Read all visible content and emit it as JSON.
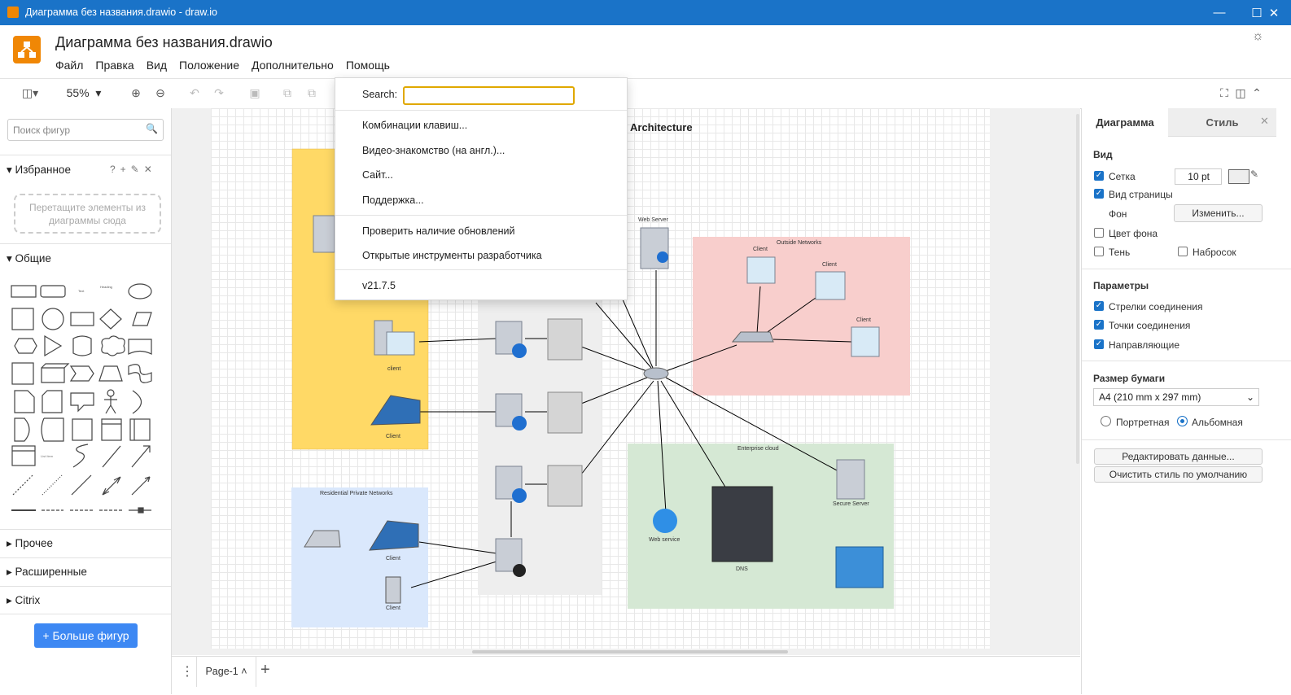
{
  "window": {
    "title": "Диаграмма без названия.drawio - draw.io",
    "controls": [
      "minimize",
      "maximize",
      "close"
    ]
  },
  "header": {
    "doc_title": "Диаграмма без названия.drawio",
    "menu": [
      "Файл",
      "Правка",
      "Вид",
      "Положение",
      "Дополнительно",
      "Помощь"
    ],
    "theme_icon": "sun-icon"
  },
  "toolbar": {
    "zoom": "55%"
  },
  "left_panel": {
    "search_placeholder": "Поиск фигур",
    "favorites": {
      "title": "Избранное",
      "drop_hint": "Перетащите элементы из диаграммы сюда"
    },
    "general_title": "Общие",
    "sections": [
      "Прочее",
      "Расширенные",
      "Citrix"
    ],
    "more_shapes": "+ Больше фигур"
  },
  "help_menu": {
    "search_label": "Search:",
    "search_value": "",
    "items": [
      "Комбинации клавиш...",
      "Видео-знакомство (на англ.)...",
      "Сайт...",
      "Поддержка..."
    ],
    "items2": [
      "Проверить наличие обновлений",
      "Открытые инструменты разработчика"
    ],
    "version": "v21.7.5"
  },
  "diagram": {
    "title": "Architecture",
    "labels": {
      "web_server": "Web Server",
      "outside_networks": "Outside Networks",
      "client": "Client",
      "client_lower": "client",
      "enterprise_cloud": "Enterprise cloud",
      "secure_server": "Secure Server",
      "web_service": "Web service",
      "dns": "DNS",
      "residential": "Residential Private Networks"
    },
    "colors": {
      "yellow_group": "#ffd966",
      "pink_group": "#f8cecc",
      "green_group": "#d5e8d4",
      "blue_group": "#dae8fc",
      "gray_group": "#eeeeee"
    }
  },
  "page_tabs": {
    "current": "Page-1"
  },
  "right_panel": {
    "tabs": [
      "Диаграмма",
      "Стиль"
    ],
    "view": {
      "title": "Вид",
      "grid": "Сетка",
      "grid_size": "10 pt",
      "page_view": "Вид страницы",
      "background": "Фон",
      "change": "Изменить...",
      "bg_color": "Цвет фона",
      "shadow": "Тень",
      "sketch": "Набросок"
    },
    "options": {
      "title": "Параметры",
      "arrows": "Стрелки соединения",
      "points": "Точки соединения",
      "guides": "Направляющие"
    },
    "paper": {
      "title": "Размер бумаги",
      "size": "A4 (210 mm x 297 mm)",
      "portrait": "Портретная",
      "landscape": "Альбомная"
    },
    "edit_data": "Редактировать данные...",
    "clear_style": "Очистить стиль по умолчанию"
  }
}
